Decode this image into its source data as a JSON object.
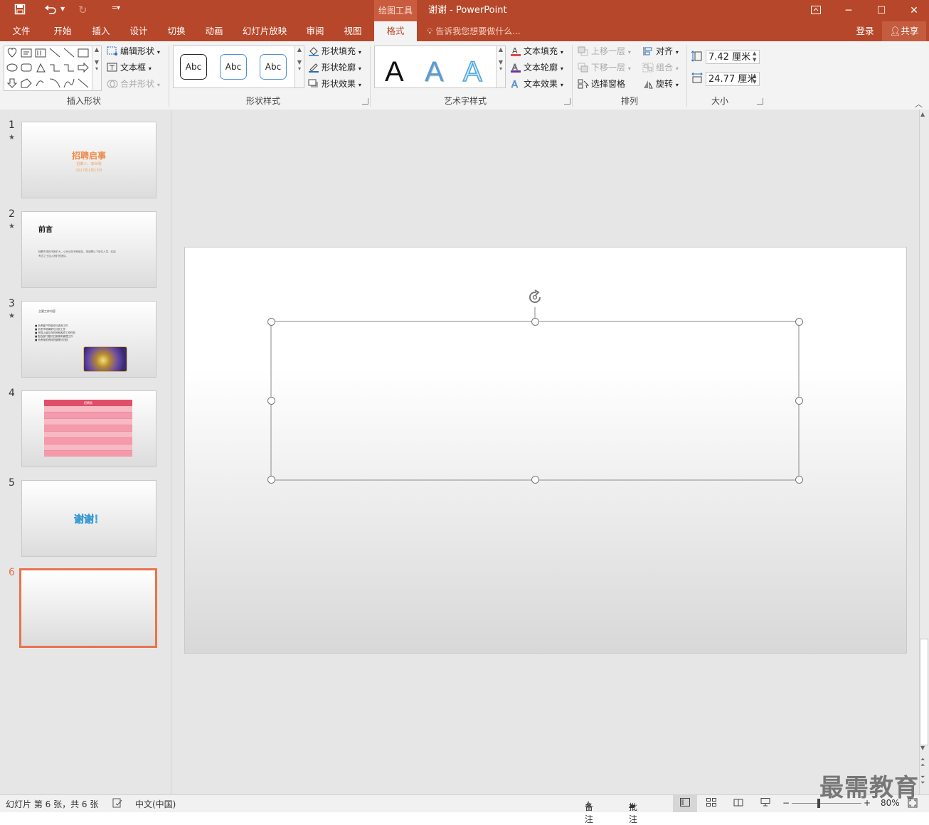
{
  "app": {
    "context_tools": "绘图工具",
    "title": "谢谢 - PowerPoint",
    "window_buttons": [
      "ribbon-display-icon",
      "minimize-icon",
      "maximize-icon",
      "close-icon"
    ]
  },
  "tabs": [
    {
      "label": "文件"
    },
    {
      "label": "开始"
    },
    {
      "label": "插入"
    },
    {
      "label": "设计"
    },
    {
      "label": "切换"
    },
    {
      "label": "动画"
    },
    {
      "label": "幻灯片放映"
    },
    {
      "label": "审阅"
    },
    {
      "label": "视图"
    },
    {
      "label": "格式",
      "active": true
    }
  ],
  "tell_me": "告诉我您想要做什么...",
  "account": {
    "signin": "登录",
    "share": "共享"
  },
  "ribbon": {
    "insert_shapes": {
      "label": "插入形状",
      "edit_shape": "编辑形状",
      "text_box": "文本框",
      "merge_shapes": "合并形状"
    },
    "shape_styles": {
      "label": "形状样式",
      "preset": [
        "Abc",
        "Abc",
        "Abc"
      ],
      "fill": "形状填充",
      "outline": "形状轮廓",
      "effects": "形状效果"
    },
    "wordart_styles": {
      "label": "艺术字样式",
      "preset": [
        "A",
        "A",
        "A"
      ],
      "text_fill": "文本填充",
      "text_outline": "文本轮廓",
      "text_effects": "文本效果"
    },
    "arrange": {
      "label": "排列",
      "bring_forward": "上移一层",
      "send_backward": "下移一层",
      "selection_pane": "选择窗格",
      "align": "对齐",
      "group": "组合",
      "rotate": "旋转"
    },
    "size": {
      "label": "大小",
      "height": "7.42 厘米",
      "width": "24.77 厘米"
    }
  },
  "slides": [
    {
      "num": "1",
      "star": true,
      "title": "招聘启事",
      "subtitle": "招聘人：李世明",
      "date": "2017年1月13日"
    },
    {
      "num": "2",
      "star": true,
      "title": "前言",
      "body": "随着市场的不断扩大，公司业务不断增加，现诚聘以下岗位人员，欢迎有志之士加入我们的团队。"
    },
    {
      "num": "3",
      "star": true,
      "heading": "主要工作内容",
      "bullets": [
        "负责客户的接待与咨询工作",
        "负责市场调研与分析工作",
        "完成上级交办的其他各项工作任务",
        "配合部门做好日常事务管理工作",
        "负责相关资料的整理与归档"
      ]
    },
    {
      "num": "4",
      "star": false,
      "table_title": "招聘表"
    },
    {
      "num": "5",
      "star": false,
      "title": "谢谢！"
    },
    {
      "num": "6",
      "star": false,
      "selected": true
    }
  ],
  "status": {
    "slide_info": "幻灯片 第 6 张，共 6 张",
    "language": "中文(中国)",
    "notes": "备注",
    "comments": "批注",
    "zoom": "80%"
  },
  "watermark": "最需教育",
  "colors": {
    "accent": "#b7472a",
    "selected_slide_border": "#e8734e"
  }
}
